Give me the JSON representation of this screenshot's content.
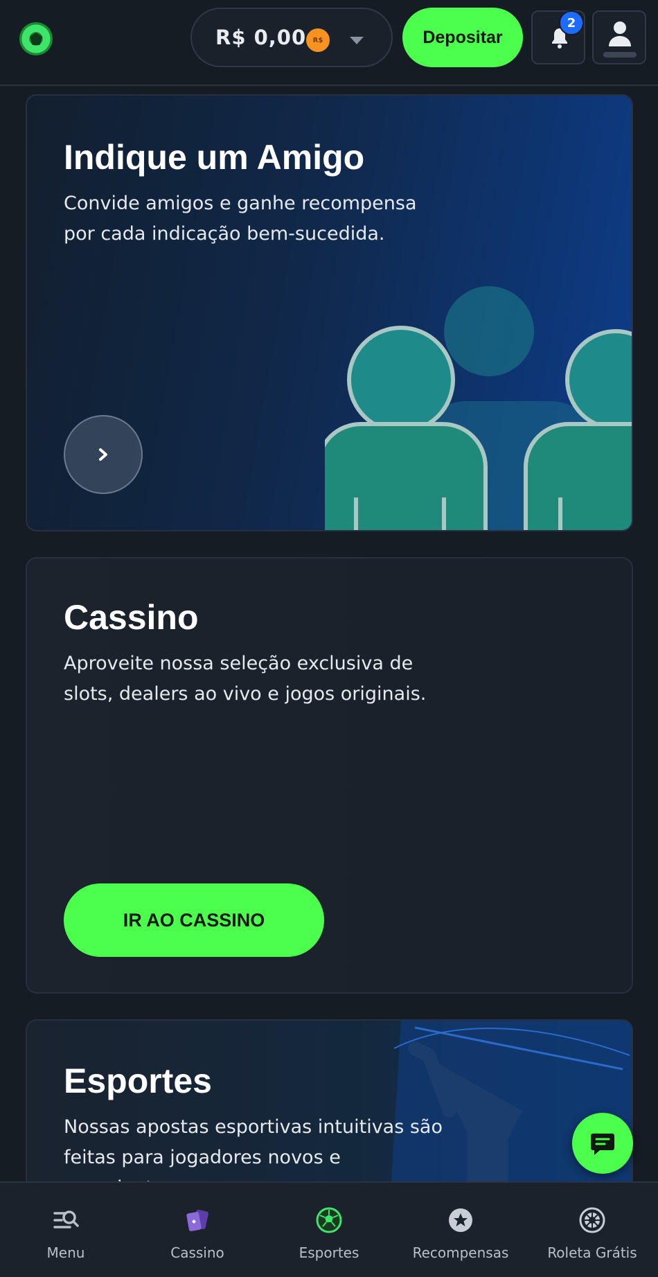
{
  "header": {
    "balance": "R$ 0,00",
    "coin_label": "R$",
    "deposit_label": "Depositar",
    "notification_count": "2"
  },
  "cards": {
    "referral": {
      "title": "Indique um Amigo",
      "description": "Convide amigos e ganhe recompensa por cada indicação bem-sucedida."
    },
    "casino": {
      "title": "Cassino",
      "description": "Aproveite nossa seleção exclusiva de slots, dealers ao vivo e jogos originais.",
      "button_label": "IR AO CASSINO"
    },
    "sports": {
      "title": "Esportes",
      "description": "Nossas apostas esportivas intuitivas são feitas para jogadores novos e experientes."
    }
  },
  "bottom_nav": {
    "items": [
      {
        "label": "Menu",
        "icon": "menu-search-icon"
      },
      {
        "label": "Cassino",
        "icon": "cards-icon"
      },
      {
        "label": "Esportes",
        "icon": "soccer-ball-icon"
      },
      {
        "label": "Recompensas",
        "icon": "star-icon"
      },
      {
        "label": "Roleta Grátis",
        "icon": "roulette-icon"
      }
    ]
  },
  "colors": {
    "accent": "#4dff4d",
    "background": "#161c24",
    "badge": "#1e6cff",
    "active_nav": "#3fe56a"
  }
}
